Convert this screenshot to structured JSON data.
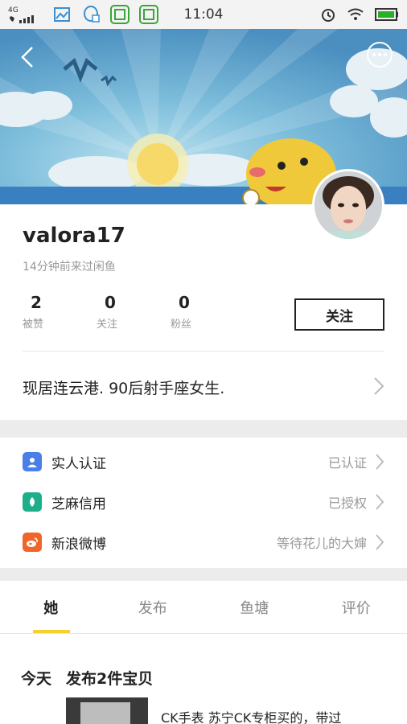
{
  "status_bar": {
    "network_top": "4G",
    "time": "11:04"
  },
  "profile": {
    "username": "valora17",
    "last_visit": "14分钟前来过闲鱼",
    "stats": [
      {
        "value": "2",
        "label": "被赞"
      },
      {
        "value": "0",
        "label": "关注"
      },
      {
        "value": "0",
        "label": "粉丝"
      }
    ],
    "follow_label": "关注",
    "bio": "现居连云港. 90后射手座女生."
  },
  "verifications": [
    {
      "label": "实人认证",
      "status": "已认证",
      "icon": "person-id-icon",
      "color": "#4a7ee8"
    },
    {
      "label": "芝麻信用",
      "status": "已授权",
      "icon": "sesame-credit-icon",
      "color": "#1fae8a"
    },
    {
      "label": "新浪微博",
      "status": "等待花儿的大婶",
      "icon": "weibo-icon",
      "color": "#f0662a"
    }
  ],
  "tabs": [
    {
      "label": "她",
      "active": true
    },
    {
      "label": "发布",
      "active": false
    },
    {
      "label": "鱼塘",
      "active": false
    },
    {
      "label": "评价",
      "active": false
    }
  ],
  "feed": {
    "day": "今天",
    "summary": "发布2件宝贝",
    "item_title": "CK手表 苏宁CK专柜买的，带过"
  },
  "colors": {
    "accent_yellow": "#f5d12e",
    "banner_sky": "#5b9fce"
  }
}
